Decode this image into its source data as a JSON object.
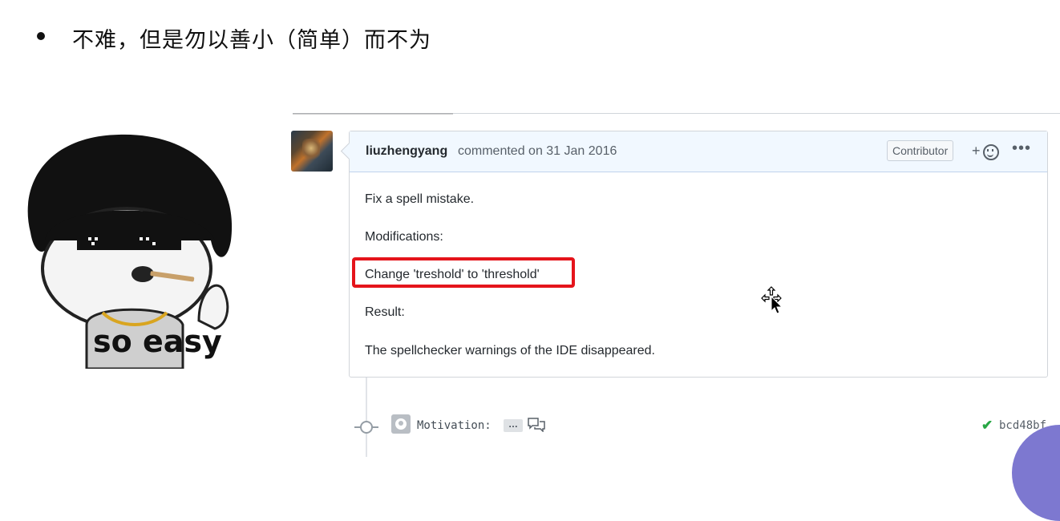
{
  "slide": {
    "title": "不难，但是勿以善小（简单）而不为"
  },
  "meme": {
    "caption": "so easy"
  },
  "comment": {
    "author": "liuzhengyang",
    "action": "commented on 31 Jan 2016",
    "role_badge": "Contributor",
    "add_reaction_label": "+",
    "more_label": "•••",
    "body": {
      "line1": "Fix a spell mistake.",
      "line2": "Modifications:",
      "line3": "Change 'treshold' to 'threshold'",
      "line4": "Result:",
      "line5": "The spellchecker warnings of the IDE disappeared."
    },
    "highlight_color": "#e5141b",
    "header_color": "#f1f8ff"
  },
  "commit": {
    "message": "Motivation:",
    "ellipsis": "…",
    "status_icon": "check-icon",
    "sha": "bcd48bf"
  }
}
